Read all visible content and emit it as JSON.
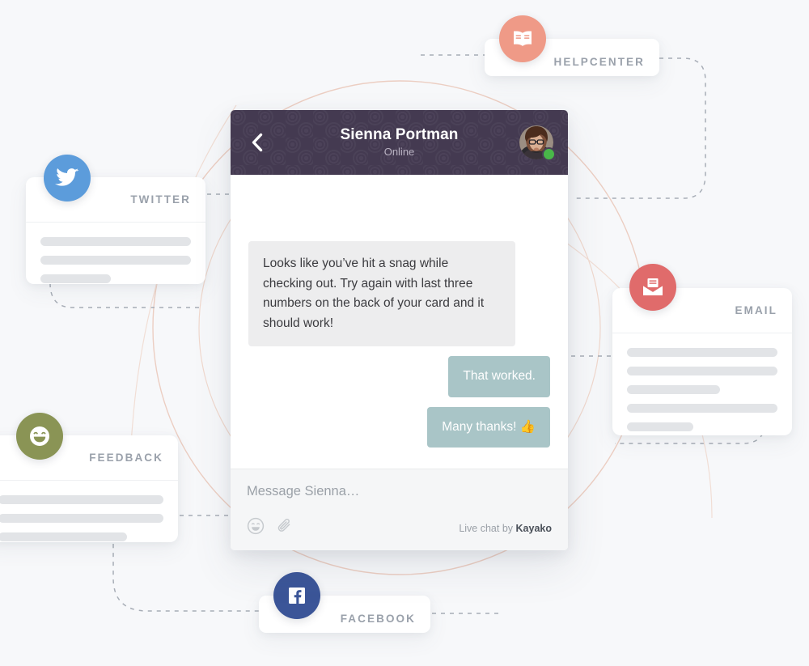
{
  "page": {
    "background_color": "#f7f8fa",
    "accent_ring_color": "#e9c4b7",
    "dashed_line_color": "#9aa1ab"
  },
  "channels": [
    {
      "key": "helpcenter",
      "label": "HELPCENTER",
      "icon": "book-icon",
      "badge_color": "#ef9a87",
      "bars": []
    },
    {
      "key": "twitter",
      "label": "TWITTER",
      "icon": "twitter-bird-icon",
      "badge_color": "#5c9cdb",
      "bars": [
        "full",
        "full",
        "short"
      ]
    },
    {
      "key": "email",
      "label": "EMAIL",
      "icon": "envelope-icon",
      "badge_color": "#e06b6b",
      "bars": [
        "full",
        "full",
        "medium",
        "full",
        "short"
      ]
    },
    {
      "key": "feedback",
      "label": "FEEDBACK",
      "icon": "smiley-icon",
      "badge_color": "#8a9455",
      "bars": [
        "full",
        "full",
        "medium"
      ]
    },
    {
      "key": "facebook",
      "label": "FACEBOOK",
      "icon": "facebook-icon",
      "badge_color": "#3b5598",
      "bars": []
    }
  ],
  "chat": {
    "header": {
      "back_icon": "chevron-left-icon",
      "agent_name": "Sienna Portman",
      "agent_status": "Online",
      "avatar_icon": "avatar",
      "online_indicator_color": "#49b749",
      "background_color": "#443a51"
    },
    "messages": [
      {
        "direction": "in",
        "text": "Looks like you’ve hit a snag while checking out. Try again with last three numbers on the back of your card and it should work!",
        "bubble_color": "#ededee"
      },
      {
        "direction": "out",
        "text": "That worked.",
        "bubble_color": "#a9c5c7"
      },
      {
        "direction": "out",
        "text": "Many thanks! 👍",
        "bubble_color": "#a9c5c7"
      }
    ],
    "footer": {
      "input_value": "",
      "input_placeholder": "Message Sienna…",
      "emoji_icon": "smiley-icon",
      "attach_icon": "paperclip-icon",
      "branding_prefix": "Live chat by ",
      "branding_brand": "Kayako"
    }
  }
}
